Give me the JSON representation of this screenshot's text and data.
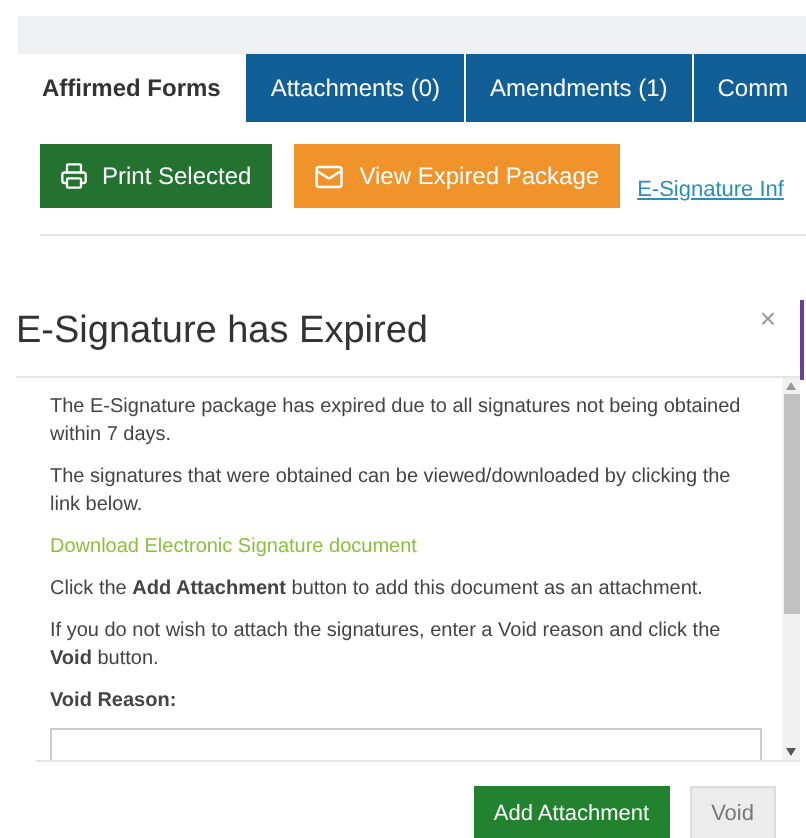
{
  "tabs": [
    {
      "label": "Affirmed Forms",
      "selected": true
    },
    {
      "label": "Attachments (0)",
      "selected": false
    },
    {
      "label": "Amendments (1)",
      "selected": false
    },
    {
      "label": "Comm",
      "selected": false
    }
  ],
  "toolbar": {
    "print_button": "Print Selected",
    "view_button": "View Expired Package",
    "link": "E-Signature Inf"
  },
  "modal": {
    "title": "E-Signature has Expired",
    "close": "×",
    "paragraphs": [
      {
        "kind": "text",
        "text": "The E-Signature package has expired due to all signatures not being obtained within 7 days."
      },
      {
        "kind": "text",
        "text": "The signatures that were obtained can be viewed/downloaded by clicking the link below."
      },
      {
        "kind": "link",
        "text": "Download Electronic Signature document"
      },
      {
        "kind": "text",
        "text": "Click the **Add Attachment** button to add this document as an attachment."
      },
      {
        "kind": "text",
        "text": "If you do not wish to attach the signatures, enter a Void reason and click the **Void** button."
      }
    ],
    "void_label": "Void Reason:",
    "buttons": [
      {
        "label": "Add Attachment",
        "disabled": false
      },
      {
        "label": "Void",
        "disabled": true
      }
    ]
  }
}
